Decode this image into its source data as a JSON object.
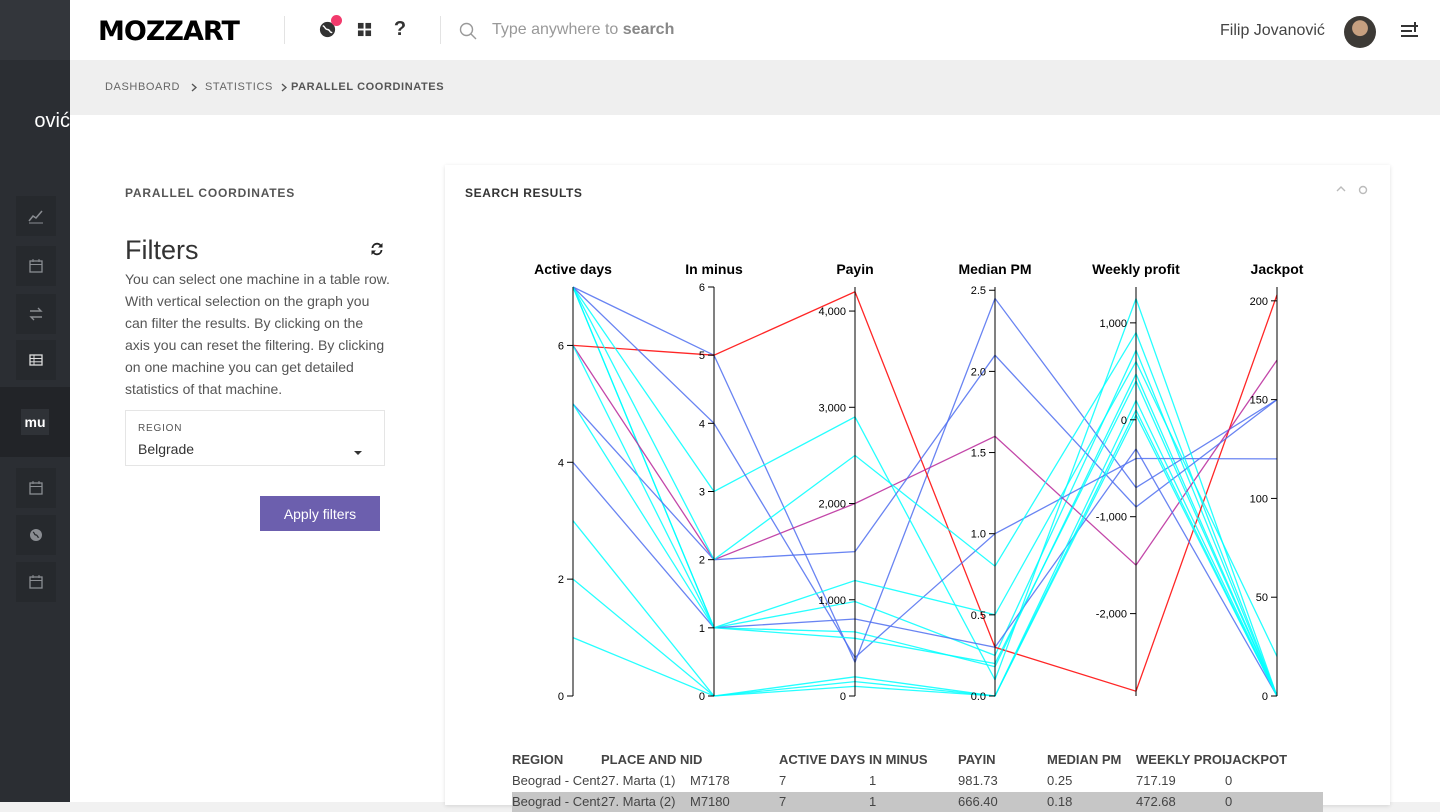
{
  "app": {
    "logo": "MOZZART"
  },
  "sidebar": {
    "user_name_fragment": "ović",
    "workspace_badge": "mu",
    "icons": [
      "chart-line-icon",
      "calendar-icon",
      "transfer-icon",
      "table-icon",
      "calendar-icon",
      "globe-icon",
      "calendar-icon"
    ]
  },
  "topbar": {
    "search_prefix": "Type anywhere to ",
    "search_bold": "search",
    "user_name": "Filip Jovanović",
    "help": "?"
  },
  "breadcrumb": [
    "DASHBOARD",
    "STATISTICS",
    "PARALLEL COORDINATES"
  ],
  "left_panel": {
    "section_label": "PARALLEL COORDINATES",
    "filters_title": "Filters",
    "description": "You can select one machine in a table row. With vertical selection on the graph you can filter the results. By clicking on the axis you can reset the filtering. By clicking on one machine you can get detailed statistics of that machine.",
    "region_label": "REGION",
    "region_value": "Belgrade",
    "apply_label": "Apply filters"
  },
  "card": {
    "title": "SEARCH RESULTS"
  },
  "chart_data": {
    "type": "parallel-coordinates",
    "axes": [
      {
        "name": "Active days",
        "range": [
          0,
          7
        ],
        "ticks": [
          "0",
          "2",
          "4",
          "6"
        ],
        "tick_values": [
          0,
          2,
          4,
          6
        ]
      },
      {
        "name": "In minus",
        "range": [
          0,
          6
        ],
        "ticks": [
          "0",
          "1",
          "2",
          "3",
          "4",
          "5",
          "6"
        ],
        "tick_values": [
          0,
          1,
          2,
          3,
          4,
          5,
          6
        ]
      },
      {
        "name": "Payin",
        "range": [
          0,
          4250
        ],
        "ticks": [
          "0",
          "1,000",
          "2,000",
          "3,000",
          "4,000"
        ],
        "tick_values": [
          0,
          1000,
          2000,
          3000,
          4000
        ]
      },
      {
        "name": "Median PM",
        "range": [
          0,
          2.52
        ],
        "ticks": [
          "0.0",
          "0.5",
          "1.0",
          "1.5",
          "2.0",
          "2.5"
        ],
        "tick_values": [
          0,
          0.5,
          1,
          1.5,
          2,
          2.5
        ]
      },
      {
        "name": "Weekly profit",
        "range": [
          -2850,
          1370
        ],
        "ticks": [
          "-2,000",
          "-1,000",
          "0",
          "1,000"
        ],
        "tick_values": [
          -2000,
          -1000,
          0,
          1000
        ]
      },
      {
        "name": "Jackpot",
        "range": [
          0,
          207
        ],
        "ticks": [
          "0",
          "50",
          "100",
          "150",
          "200"
        ],
        "tick_values": [
          0,
          50,
          100,
          150,
          200
        ]
      }
    ],
    "color_scale": [
      "#00ffff",
      "#4f6ef0",
      "#b8279a",
      "#ff0000"
    ],
    "rows": [
      [
        7,
        1,
        981.73,
        0.25,
        717.19,
        0
      ],
      [
        7,
        1,
        666.4,
        0.18,
        472.68,
        0
      ],
      [
        7,
        5,
        350,
        2.45,
        -700,
        150
      ],
      [
        6,
        5,
        4200,
        0.3,
        -2800,
        203
      ],
      [
        7,
        3,
        2900,
        0.1,
        1250,
        0
      ],
      [
        6,
        2,
        2000,
        1.6,
        -1500,
        170
      ],
      [
        5,
        2,
        1500,
        2.1,
        -900,
        150
      ],
      [
        4,
        1,
        800,
        0.3,
        -300,
        0
      ],
      [
        3,
        0,
        200,
        0.0,
        200,
        0
      ],
      [
        2,
        0,
        150,
        0.0,
        100,
        0
      ],
      [
        7,
        4,
        400,
        1.0,
        -400,
        120
      ],
      [
        6,
        1,
        1200,
        0.5,
        600,
        20
      ],
      [
        7,
        2,
        2500,
        0.8,
        900,
        0
      ],
      [
        5,
        1,
        600,
        0.2,
        400,
        0
      ],
      [
        1,
        0,
        100,
        0.0,
        50,
        0
      ]
    ]
  },
  "table": {
    "headers": [
      "REGION",
      "PLACE AND NID",
      "ACTIVE DAYS",
      "IN MINUS",
      "PAYIN",
      "MEDIAN PM",
      "WEEKLY PROFIT",
      "JACKPOT"
    ],
    "rows": [
      [
        "Beograd - Centar",
        "27. Marta (1)",
        "M7178",
        "7",
        "1",
        "981.73",
        "0.25",
        "717.19",
        "0"
      ],
      [
        "Beograd - Centar",
        "27. Marta (2)",
        "M7180",
        "7",
        "1",
        "666.40",
        "0.18",
        "472.68",
        "0"
      ]
    ]
  }
}
